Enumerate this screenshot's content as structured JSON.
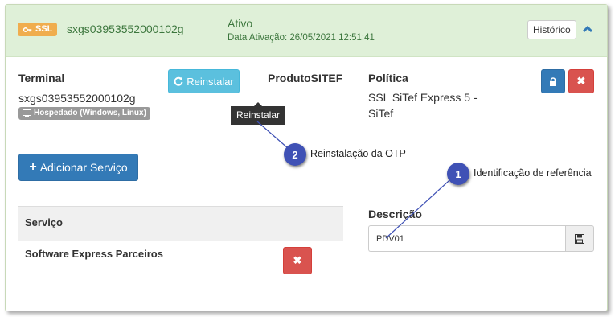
{
  "header": {
    "badge": "SSL",
    "terminal_id": "sxgs03953552000102g",
    "status": "Ativo",
    "activation_date": "Data Ativação: 26/05/2021 12:51:41",
    "history_button": "Histórico",
    "accent": "#dff0d8"
  },
  "terminal": {
    "label": "Terminal",
    "value": "sxgs03953552000102g",
    "hosted_tag": "Hospedado (Windows, Linux)",
    "reinstall_button": "Reinstalar"
  },
  "product": {
    "label": "ProdutoSITEF"
  },
  "policy": {
    "label": "Política",
    "value_line1": "SSL SiTef Express 5 -",
    "value_line2": "SiTef"
  },
  "tooltip": "Reinstalar",
  "add_service_button": "Adicionar Serviço",
  "services": {
    "header": "Serviço",
    "rows": [
      {
        "name": "Software Express Parceiros"
      }
    ]
  },
  "description": {
    "label": "Descrição",
    "value": "PDV01"
  },
  "annotations": [
    {
      "number": "1",
      "text": "Identificação de referência"
    },
    {
      "number": "2",
      "text": "Reinstalação da OTP"
    }
  ],
  "icons": {
    "badge": "key-icon",
    "hosted": "monitor-icon",
    "reinstall": "refresh-icon",
    "lock": "lock-icon",
    "delete": "close-icon",
    "add": "plus-icon",
    "save": "floppy-icon",
    "collapse": "chevron-up-icon"
  }
}
